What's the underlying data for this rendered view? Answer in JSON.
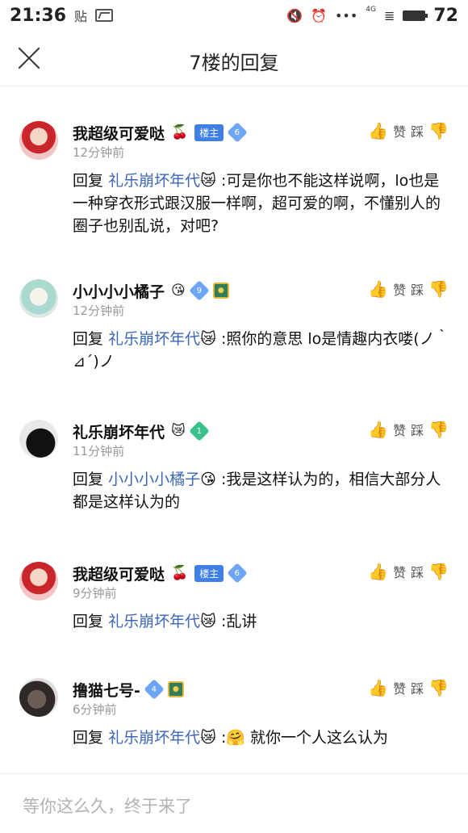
{
  "status_bar": {
    "time": "21:36",
    "paste_label": "贴",
    "signal_text": "4G",
    "battery": "72"
  },
  "header": {
    "title": "7楼的回复"
  },
  "comments": [
    {
      "name": "我超级可爱哒",
      "name_emoji": "🍒",
      "badge": "楼主",
      "level": "6",
      "time": "12分钟前",
      "reply_prefix": "回复",
      "reply_to": "礼乐崩坏年代",
      "reply_to_emoji": "😿",
      "text": ":可是你也不能这样说啊，lo也是一种穿衣形式跟汉服一样啊，超可爱的啊，不懂别人的圈子也别乱说，对吧?",
      "like_label": "赞",
      "dislike_label": "踩"
    },
    {
      "name": "小小小小橘子",
      "name_emoji": "😘",
      "level": "9",
      "time": "12分钟前",
      "reply_prefix": "回复",
      "reply_to": "礼乐崩坏年代",
      "reply_to_emoji": "😿",
      "text": ":照你的意思 lo是情趣内衣喽(ノ｀⊿´)ノ",
      "like_label": "赞",
      "dislike_label": "踩"
    },
    {
      "name": "礼乐崩坏年代",
      "name_emoji": "😿",
      "level": "1",
      "time": "11分钟前",
      "reply_prefix": "回复",
      "reply_to": "小小小小橘子",
      "reply_to_emoji": "😘",
      "text": ":我是这样认为的，相信大部分人都是这样认为的",
      "like_label": "赞",
      "dislike_label": "踩"
    },
    {
      "name": "我超级可爱哒",
      "name_emoji": "🍒",
      "badge": "楼主",
      "level": "6",
      "time": "9分钟前",
      "reply_prefix": "回复",
      "reply_to": "礼乐崩坏年代",
      "reply_to_emoji": "😿",
      "text": ":乱讲",
      "like_label": "赞",
      "dislike_label": "踩"
    },
    {
      "name": "撸猫七号-",
      "level": "4",
      "time": "6分钟前",
      "reply_prefix": "回复",
      "reply_to": "礼乐崩坏年代",
      "reply_to_emoji": "😿",
      "text": ":🤗 就你一个人这么认为",
      "like_label": "赞",
      "dislike_label": "踩"
    }
  ],
  "input": {
    "placeholder": "等你这么久，终于来了"
  },
  "colors": {
    "link": "#3b66b8",
    "host_badge": "#3f80e8",
    "time_gray": "#999999"
  }
}
